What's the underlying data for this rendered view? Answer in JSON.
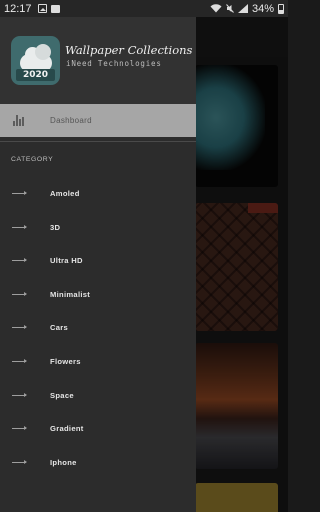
{
  "status_bar": {
    "time": "12:17",
    "battery": "34%",
    "icons": [
      "image-icon",
      "bag-icon",
      "wifi-icon",
      "mute-icon",
      "signal-icon",
      "battery-icon"
    ]
  },
  "drawer": {
    "app_title": "Wallpaper Collections",
    "app_subtitle": "iNeed Technologies",
    "logo_year": "2020",
    "dashboard_label": "Dashboard",
    "category_header": "CATEGORY",
    "categories": [
      {
        "label": "Amoled",
        "icon": "arrow-right-icon"
      },
      {
        "label": "3D",
        "icon": "arrow-right-icon"
      },
      {
        "label": "Ultra HD",
        "icon": "arrow-right-icon"
      },
      {
        "label": "Minimalist",
        "icon": "arrow-right-icon"
      },
      {
        "label": "Cars",
        "icon": "arrow-right-icon"
      },
      {
        "label": "Flowers",
        "icon": "arrow-right-icon"
      },
      {
        "label": "Space",
        "icon": "arrow-right-icon"
      },
      {
        "label": "Gradient",
        "icon": "arrow-right-icon"
      },
      {
        "label": "Iphone",
        "icon": "arrow-right-icon"
      }
    ]
  },
  "colors": {
    "drawer_bg": "#2c2c2c",
    "header_bg": "#323232",
    "selected_item_bg": "#a6a6a6",
    "logo_teal": "#3f6b6d"
  }
}
